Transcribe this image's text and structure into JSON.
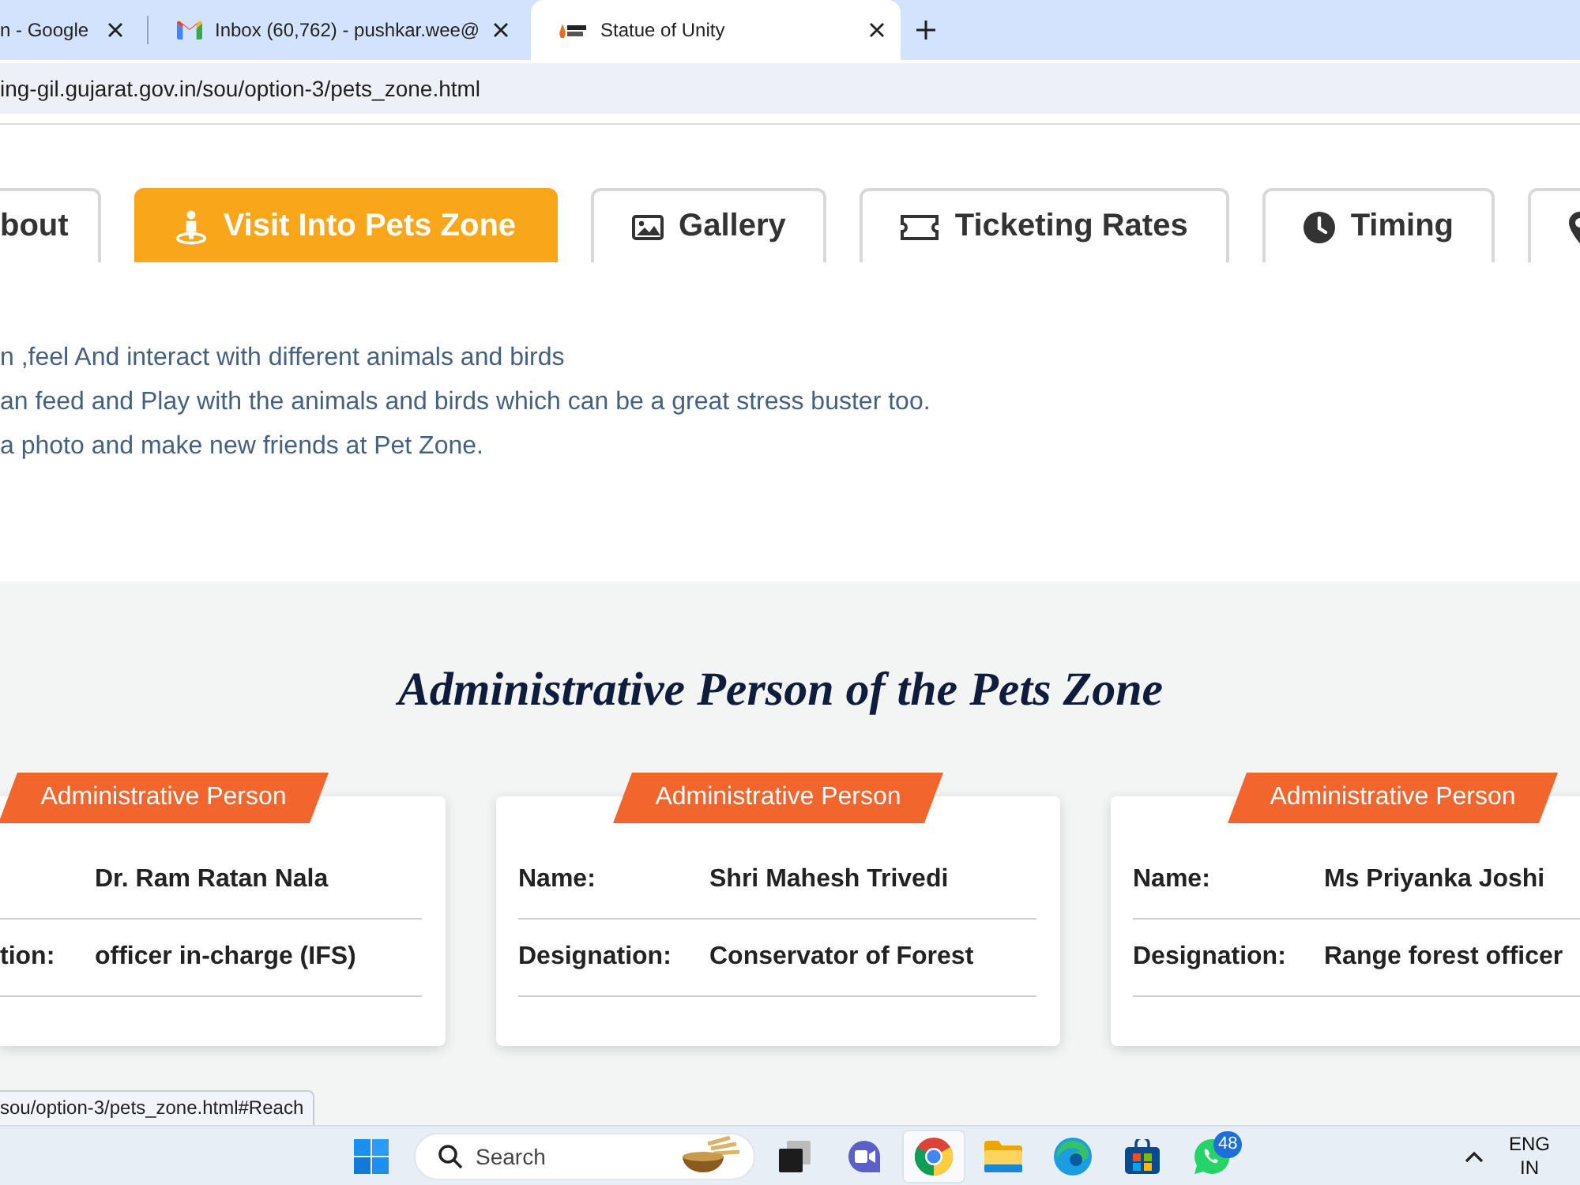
{
  "browser": {
    "tabs": [
      {
        "title": "n - Google",
        "selected": false
      },
      {
        "title": "Inbox (60,762) - pushkar.wee@",
        "selected": false
      },
      {
        "title": "Statue of Unity",
        "selected": true
      }
    ],
    "address": "ing-gil.gujarat.gov.in/sou/option-3/pets_zone.html"
  },
  "section_tabs": [
    {
      "label": "bout",
      "selected": false
    },
    {
      "label": "Visit Into Pets Zone",
      "selected": true
    },
    {
      "label": "Gallery",
      "selected": false
    },
    {
      "label": "Ticketing Rates",
      "selected": false
    },
    {
      "label": "Timing",
      "selected": false
    },
    {
      "selected": false
    }
  ],
  "description": [
    "n ,feel And interact with different animals and birds",
    "an feed and Play with the animals and birds which can be a great stress buster too.",
    "a photo and make new friends at Pet Zone."
  ],
  "admin_section": {
    "heading": "Administrative Person of the Pets Zone",
    "cards": [
      {
        "badge": "Administrative Person",
        "rows": [
          {
            "value": "Dr. Ram Ratan Nala"
          },
          {
            "label": "tion:",
            "value": "officer in-charge (IFS)"
          }
        ]
      },
      {
        "badge": "Administrative Person",
        "rows": [
          {
            "label": "Name:",
            "value": "Shri Mahesh Trivedi"
          },
          {
            "label": "Designation:",
            "value": "Conservator of Forest"
          }
        ]
      },
      {
        "badge": "Administrative Person",
        "rows": [
          {
            "label": "Name:",
            "value": "Ms Priyanka Joshi"
          },
          {
            "label": "Designation:",
            "value": "Range forest officer"
          }
        ]
      }
    ]
  },
  "status_url": "sou/option-3/pets_zone.html#Reach",
  "taskbar": {
    "search": {
      "placeholder": "Search"
    },
    "apps": [
      {
        "selected": false
      },
      {
        "selected": false
      },
      {
        "selected": true
      },
      {
        "selected": false
      },
      {
        "selected": false
      },
      {
        "selected": false
      },
      {
        "selected": false,
        "badge": "48"
      }
    ],
    "language": "ENG",
    "region": "IN"
  }
}
